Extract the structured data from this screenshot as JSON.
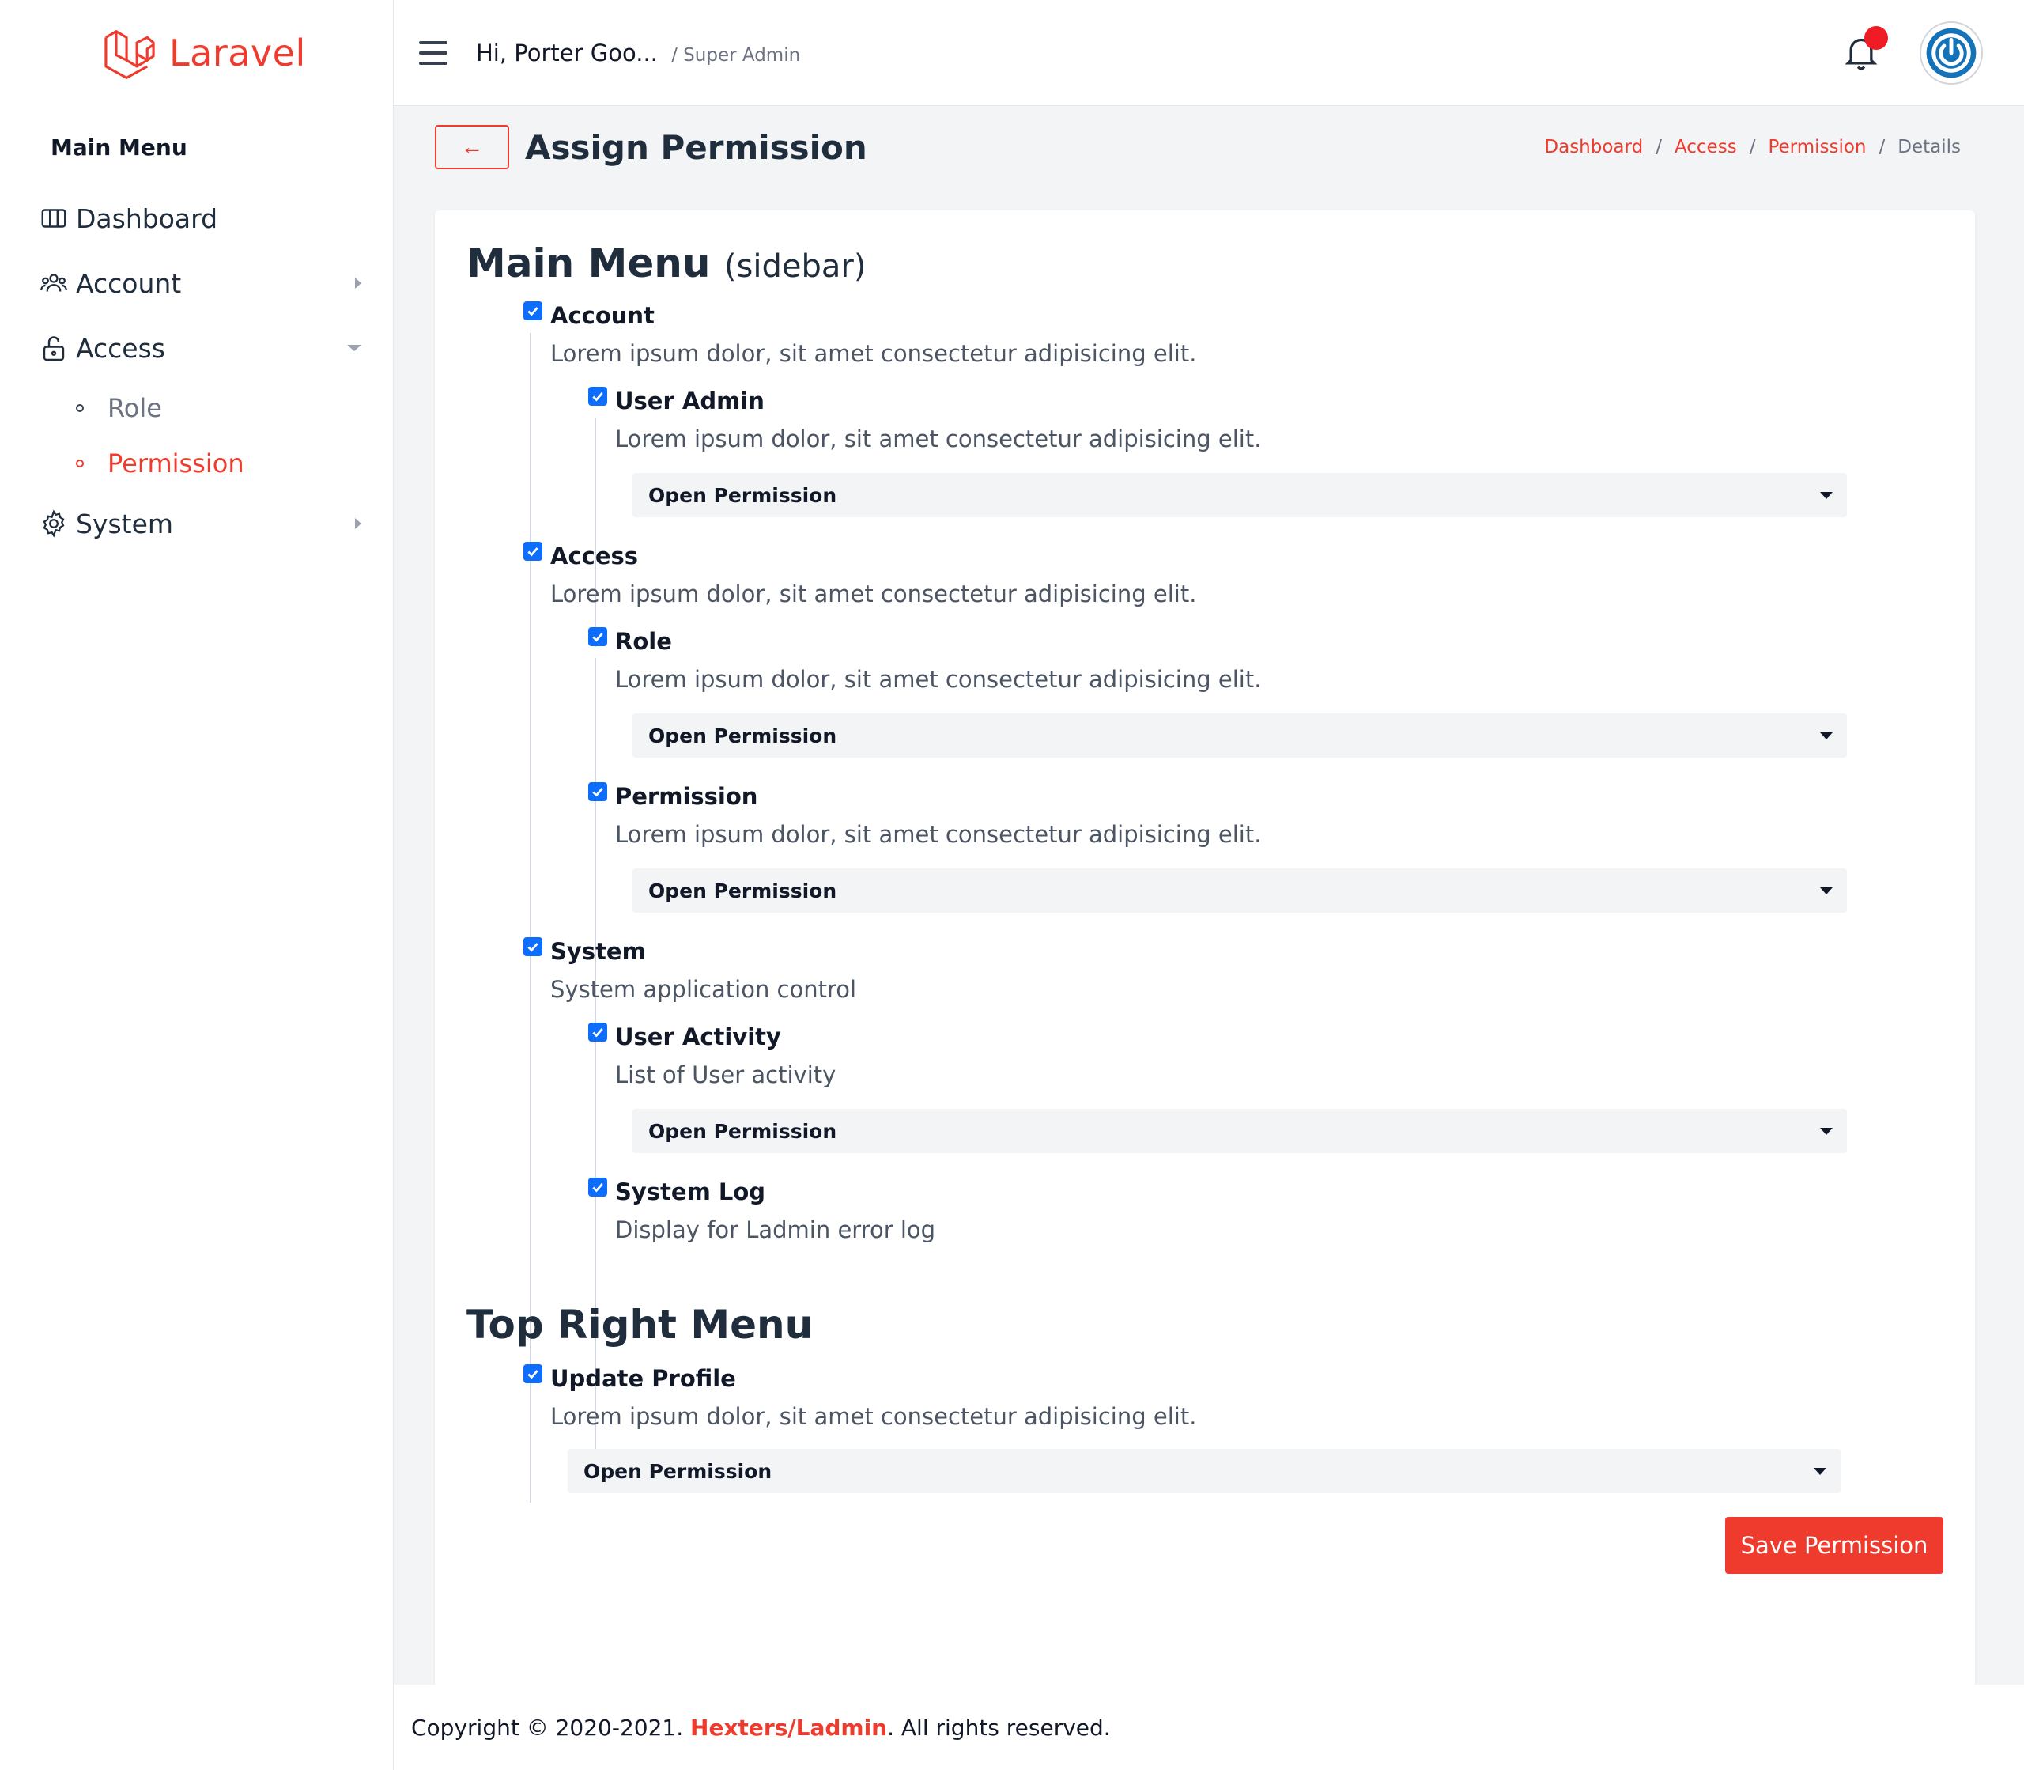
{
  "brand": {
    "name": "Laravel",
    "color": "#ef3b2d"
  },
  "sidebar": {
    "title": "Main Menu",
    "items": [
      {
        "label": "Dashboard",
        "icon": "columns-icon"
      },
      {
        "label": "Account",
        "icon": "users-icon"
      },
      {
        "label": "Access",
        "icon": "unlock-icon"
      },
      {
        "label": "System",
        "icon": "gear-icon"
      }
    ],
    "access_children": [
      {
        "label": "Role"
      },
      {
        "label": "Permission",
        "active": true
      }
    ]
  },
  "header": {
    "greeting": "Hi, Porter Goo...",
    "role": "/ Super Admin",
    "notification_dot": true
  },
  "page": {
    "back_label": "←",
    "title": "Assign Permission",
    "breadcrumb": [
      "Dashboard",
      "Access",
      "Permission"
    ],
    "breadcrumb_sep": "/",
    "breadcrumb_current": "Details"
  },
  "sections": {
    "main_menu": {
      "title": "Main Menu",
      "subtitle": "(sidebar)"
    },
    "top_right": {
      "title": "Top Right Menu"
    }
  },
  "permissions": {
    "account": {
      "name": "Account",
      "desc": "Lorem ipsum dolor, sit amet consectetur adipisicing elit.",
      "checked": true
    },
    "user_admin": {
      "name": "User Admin",
      "desc": "Lorem ipsum dolor, sit amet consectetur adipisicing elit.",
      "checked": true,
      "select": "Open Permission"
    },
    "access": {
      "name": "Access",
      "desc": "Lorem ipsum dolor, sit amet consectetur adipisicing elit.",
      "checked": true
    },
    "role": {
      "name": "Role",
      "desc": "Lorem ipsum dolor, sit amet consectetur adipisicing elit.",
      "checked": true,
      "select": "Open Permission"
    },
    "permission": {
      "name": "Permission",
      "desc": "Lorem ipsum dolor, sit amet consectetur adipisicing elit.",
      "checked": true,
      "select": "Open Permission"
    },
    "system": {
      "name": "System",
      "desc": "System application control",
      "checked": true
    },
    "user_activity": {
      "name": "User Activity",
      "desc": "List of User activity",
      "checked": true,
      "select": "Open Permission"
    },
    "system_log": {
      "name": "System Log",
      "desc": "Display for Ladmin error log",
      "checked": true
    },
    "update_profile": {
      "name": "Update Profile",
      "desc": "Lorem ipsum dolor, sit amet consectetur adipisicing elit.",
      "checked": true,
      "select": "Open Permission"
    }
  },
  "actions": {
    "save_label": "Save Permission"
  },
  "footer": {
    "prefix": "Copyright © 2020-2021.",
    "brand": "Hexters/Ladmin",
    "suffix": ". All rights reserved."
  }
}
